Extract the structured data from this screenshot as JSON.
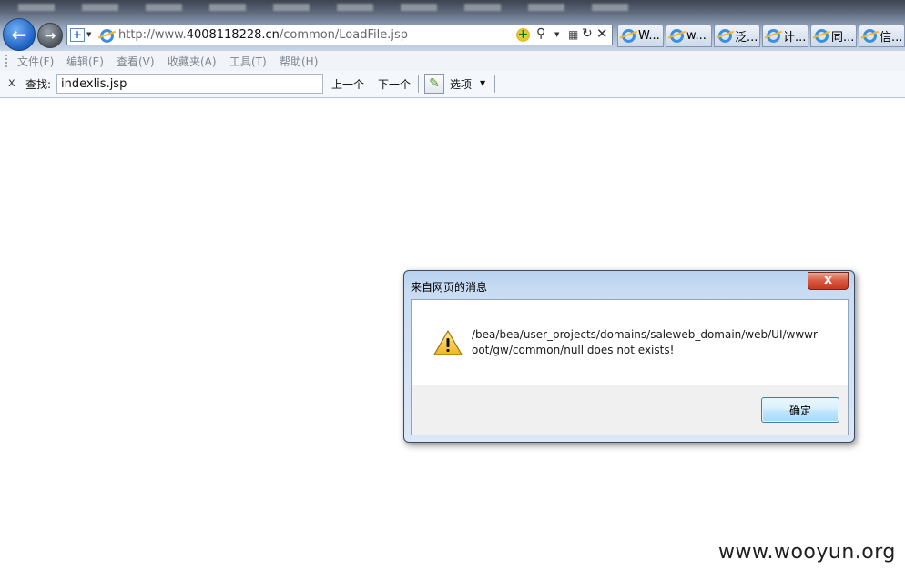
{
  "address_bar": {
    "url_prefix": "http://www.",
    "url_domain": "4008118228.cn",
    "url_path": "/common/LoadFile.jsp"
  },
  "tabs": [
    {
      "label": "W..."
    },
    {
      "label": "w..."
    },
    {
      "label": "泛..."
    },
    {
      "label": "计..."
    },
    {
      "label": "同..."
    },
    {
      "label": "信..."
    }
  ],
  "menu": [
    {
      "label": "文件(F)"
    },
    {
      "label": "编辑(E)"
    },
    {
      "label": "查看(V)"
    },
    {
      "label": "收藏夹(A)"
    },
    {
      "label": "工具(T)"
    },
    {
      "label": "帮助(H)"
    }
  ],
  "find_bar": {
    "close_glyph": "x",
    "label": "查找:",
    "input_value": "indexlis.jsp",
    "prev_label": "上一个",
    "next_label": "下一个",
    "options_label": "选项"
  },
  "dialog": {
    "title": "来自网页的消息",
    "close_glyph": "x",
    "message": "/bea/bea/user_projects/domains/saleweb_domain/web/UI/wwwroot/gw/common/null does not exists!",
    "ok_label": "确定",
    "icon": "warning-icon"
  },
  "watermark": "www.wooyun.org"
}
